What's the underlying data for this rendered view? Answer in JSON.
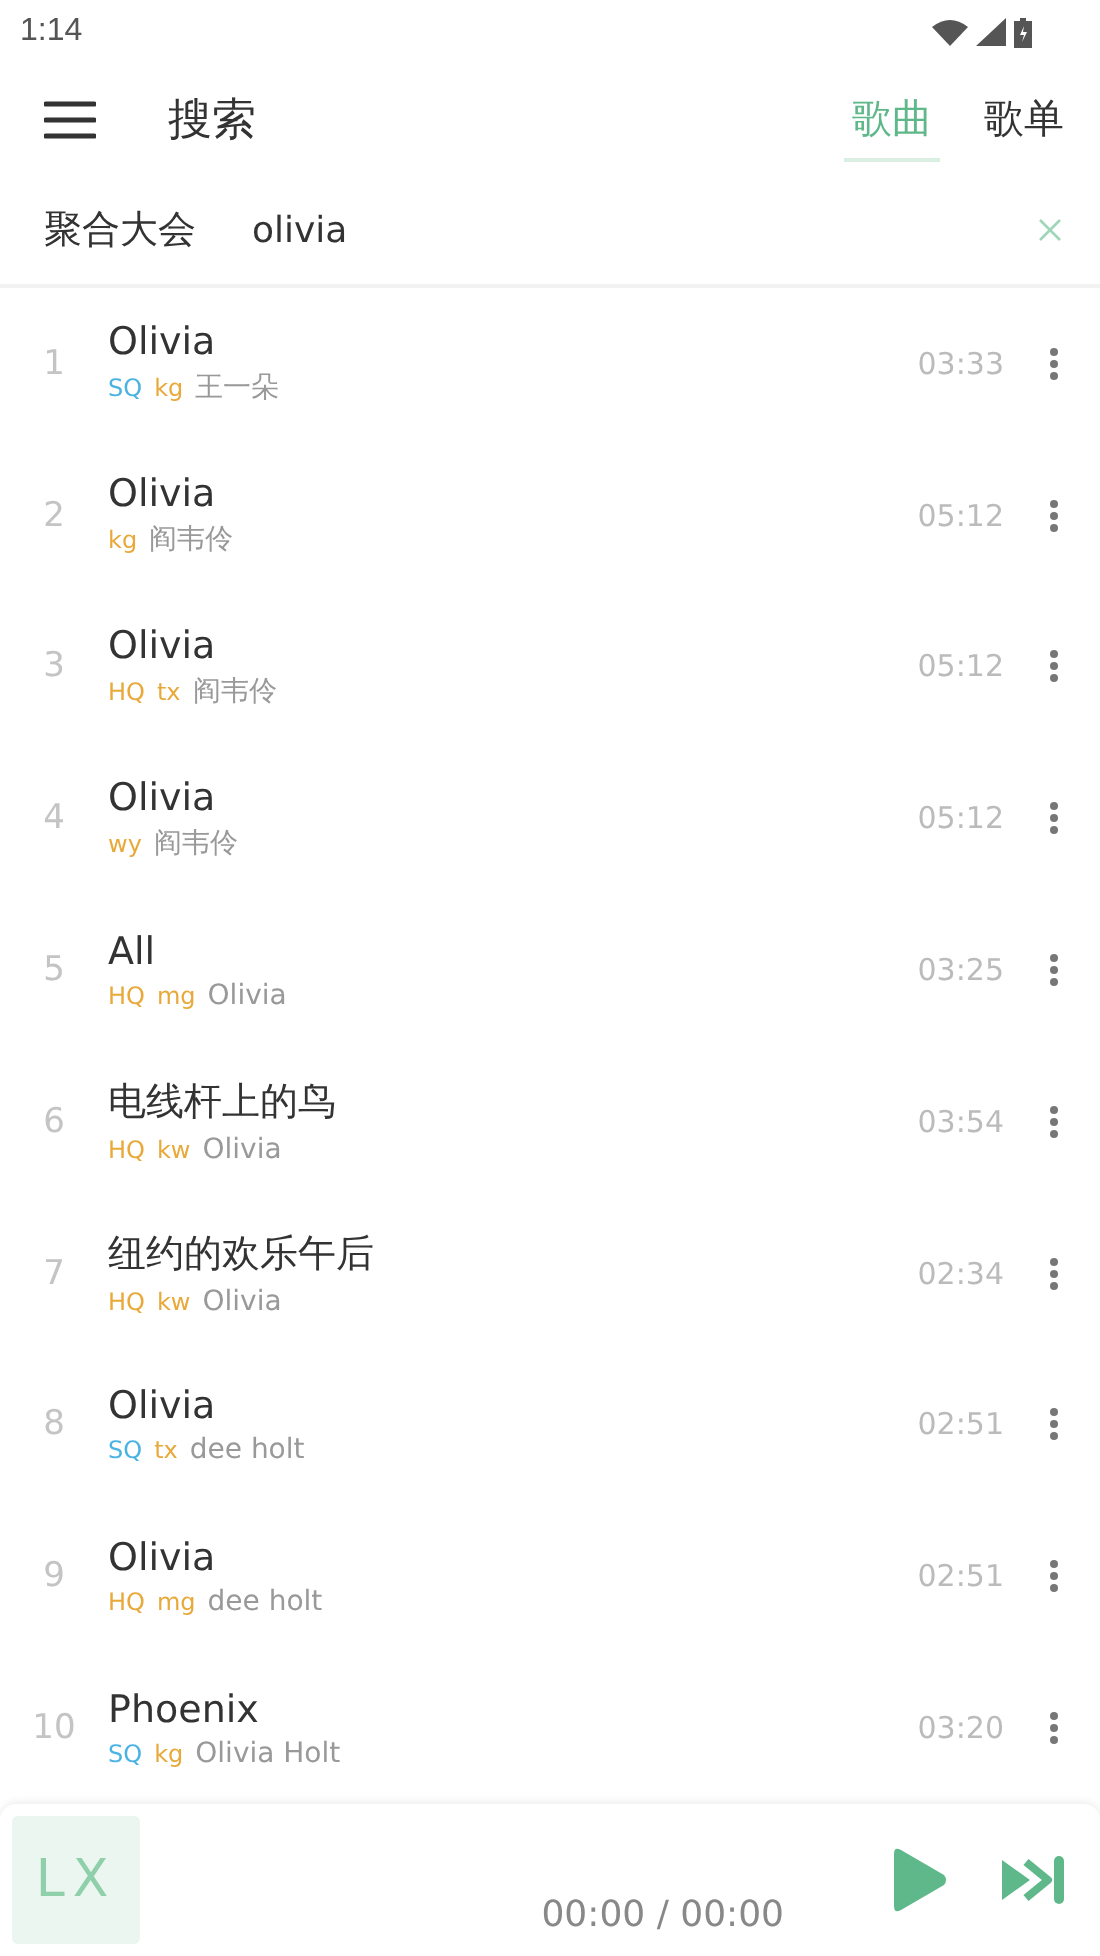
{
  "status_bar": {
    "time": "1:14"
  },
  "header": {
    "title": "搜索",
    "tabs": [
      {
        "label": "歌曲",
        "selected": true
      },
      {
        "label": "歌单",
        "selected": false
      }
    ]
  },
  "search": {
    "source": "聚合大会",
    "value": "olivia"
  },
  "songs": [
    {
      "index": "1",
      "title": "Olivia",
      "tags": [
        {
          "text": "SQ",
          "color": "#4ab3e2"
        },
        {
          "text": "kg",
          "color": "#e8a93a"
        }
      ],
      "artist": "王一朵",
      "duration": "03:33"
    },
    {
      "index": "2",
      "title": "Olivia",
      "tags": [
        {
          "text": "kg",
          "color": "#e8a93a"
        }
      ],
      "artist": "阎韦伶",
      "duration": "05:12"
    },
    {
      "index": "3",
      "title": "Olivia",
      "tags": [
        {
          "text": "HQ",
          "color": "#e8a93a"
        },
        {
          "text": "tx",
          "color": "#e8a93a"
        }
      ],
      "artist": "阎韦伶",
      "duration": "05:12"
    },
    {
      "index": "4",
      "title": "Olivia",
      "tags": [
        {
          "text": "wy",
          "color": "#e8a93a"
        }
      ],
      "artist": "阎韦伶",
      "duration": "05:12"
    },
    {
      "index": "5",
      "title": "All",
      "tags": [
        {
          "text": "HQ",
          "color": "#e8a93a"
        },
        {
          "text": "mg",
          "color": "#e8a93a"
        }
      ],
      "artist": "Olivia",
      "duration": "03:25"
    },
    {
      "index": "6",
      "title": "电线杆上的鸟",
      "tags": [
        {
          "text": "HQ",
          "color": "#e8a93a"
        },
        {
          "text": "kw",
          "color": "#e8a93a"
        }
      ],
      "artist": "Olivia",
      "duration": "03:54"
    },
    {
      "index": "7",
      "title": "纽约的欢乐午后",
      "tags": [
        {
          "text": "HQ",
          "color": "#e8a93a"
        },
        {
          "text": "kw",
          "color": "#e8a93a"
        }
      ],
      "artist": "Olivia",
      "duration": "02:34"
    },
    {
      "index": "8",
      "title": "Olivia",
      "tags": [
        {
          "text": "SQ",
          "color": "#4ab3e2"
        },
        {
          "text": "tx",
          "color": "#e8a93a"
        }
      ],
      "artist": "dee holt",
      "duration": "02:51"
    },
    {
      "index": "9",
      "title": "Olivia",
      "tags": [
        {
          "text": "HQ",
          "color": "#e8a93a"
        },
        {
          "text": "mg",
          "color": "#e8a93a"
        }
      ],
      "artist": "dee holt",
      "duration": "02:51"
    },
    {
      "index": "10",
      "title": "Phoenix",
      "tags": [
        {
          "text": "SQ",
          "color": "#4ab3e2"
        },
        {
          "text": "kg",
          "color": "#e8a93a"
        }
      ],
      "artist": "Olivia Holt",
      "duration": "03:20"
    }
  ],
  "player": {
    "logo": "LX",
    "time": "00:00 / 00:00"
  }
}
